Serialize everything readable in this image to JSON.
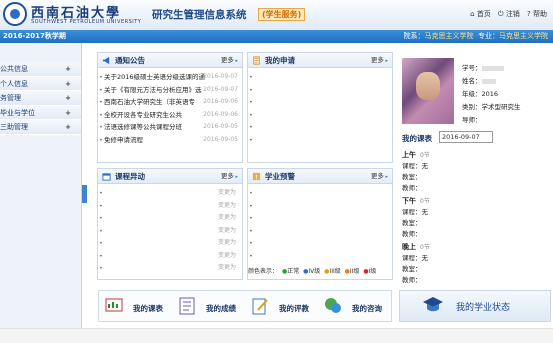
{
  "header": {
    "university_cn": "西南石油大學",
    "university_en": "SOUTHWEST PETROLEUM UNIVERSITY",
    "system_title": "研究生管理信息系统",
    "system_badge": "(学生服务)",
    "links": [
      "首页",
      "注销",
      "帮助"
    ]
  },
  "bar": {
    "semester": "2016-2017秋学期",
    "college_label": "院系：",
    "college_value": "马克思主义学院",
    "major_label": "专业：",
    "major_value": "马克思主义学院"
  },
  "sidebar": {
    "items": [
      "公共信息",
      "个人信息",
      "务管理",
      "毕业与学位",
      "三助管理"
    ]
  },
  "notice": {
    "title": "通知公告",
    "more": "更多",
    "items": [
      {
        "text": "关于2016级硕士英语分级选课的通",
        "date": "2016-09-07"
      },
      {
        "text": "关于《有限元方法与分析应用》选",
        "date": "2016-09-07"
      },
      {
        "text": "西南石油大学研究生（非英语专",
        "date": "2016-09-06"
      },
      {
        "text": "全校开设各专业研究生公共",
        "date": "2016-09-06"
      },
      {
        "text": "法语选修课等公共课程分班",
        "date": "2016-09-05"
      },
      {
        "text": "免修申请流程",
        "date": "2016-09-05"
      }
    ]
  },
  "myapply": {
    "title": "我的申请",
    "more": "更多"
  },
  "change": {
    "title": "课程异动",
    "more": "更多",
    "items": [
      "变更为",
      "变更为",
      "变更为",
      "变更为",
      "变更为",
      "变更为",
      "变更为"
    ]
  },
  "warn": {
    "title": "学业预警",
    "more": "更多"
  },
  "legend": {
    "label": "颜色表示：",
    "items": [
      "正常",
      "IV级",
      "III级",
      "II级",
      "I级"
    ],
    "colors": [
      "#2aa12a",
      "#2b6fd0",
      "#e0a000",
      "#f07b1a",
      "#e02020"
    ]
  },
  "profile": {
    "id_label": "学号：",
    "name_label": "姓名：",
    "grade_label": "年级：",
    "grade_value": "2016",
    "type_label": "类别：",
    "type_value": "学术型研究生",
    "tutor_label": "导师："
  },
  "mycourse": {
    "title": "我的课表",
    "date": "2016-09-07",
    "slots": [
      {
        "name": "上午",
        "count": "0节",
        "course": "课程：无",
        "room": "教室：",
        "teacher": "教师："
      },
      {
        "name": "下午",
        "count": "0节",
        "course": "课程：无",
        "room": "教室：",
        "teacher": "教师："
      },
      {
        "name": "晚上",
        "count": "0节",
        "course": "课程：无",
        "room": "教室：",
        "teacher": "教师："
      }
    ]
  },
  "bottom": {
    "buttons": [
      "我的课表",
      "我的成绩",
      "我的评教",
      "我的咨询"
    ],
    "status": "我的学业状态"
  }
}
